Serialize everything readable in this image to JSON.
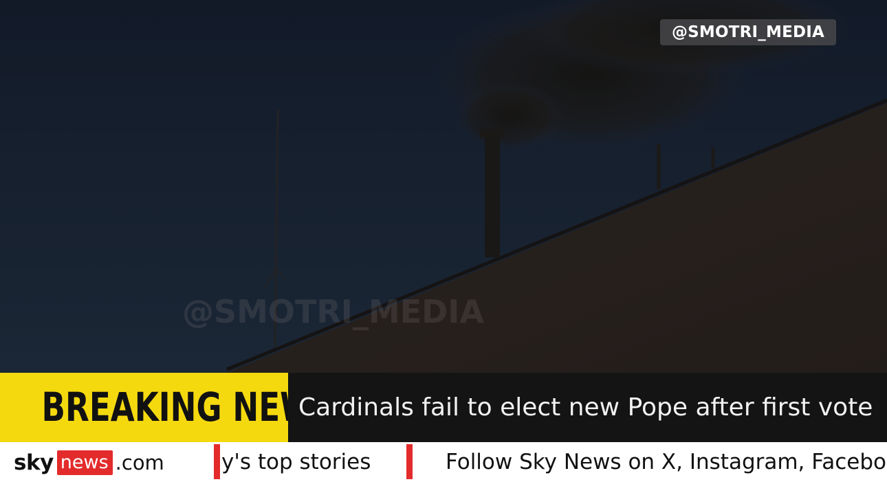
{
  "overlay": {
    "handle": "@SMOTRI_MEDIA",
    "watermark": "@SMOTRI_MEDIA"
  },
  "breaking": {
    "label": "BREAKING NEWS",
    "headline": "Cardinals fail to elect new Pope after first vote"
  },
  "ticker": {
    "logo_sky": "sky",
    "logo_news": "news",
    "logo_com": ".com",
    "items": [
      "y's top stories",
      "Follow Sky News on X, Instagram, Facebook"
    ]
  },
  "colors": {
    "breaking_yellow": "#f5d90f",
    "sky_red": "#e32b2b",
    "night_sky": "#162030",
    "ticker_bg": "#ffffff"
  }
}
